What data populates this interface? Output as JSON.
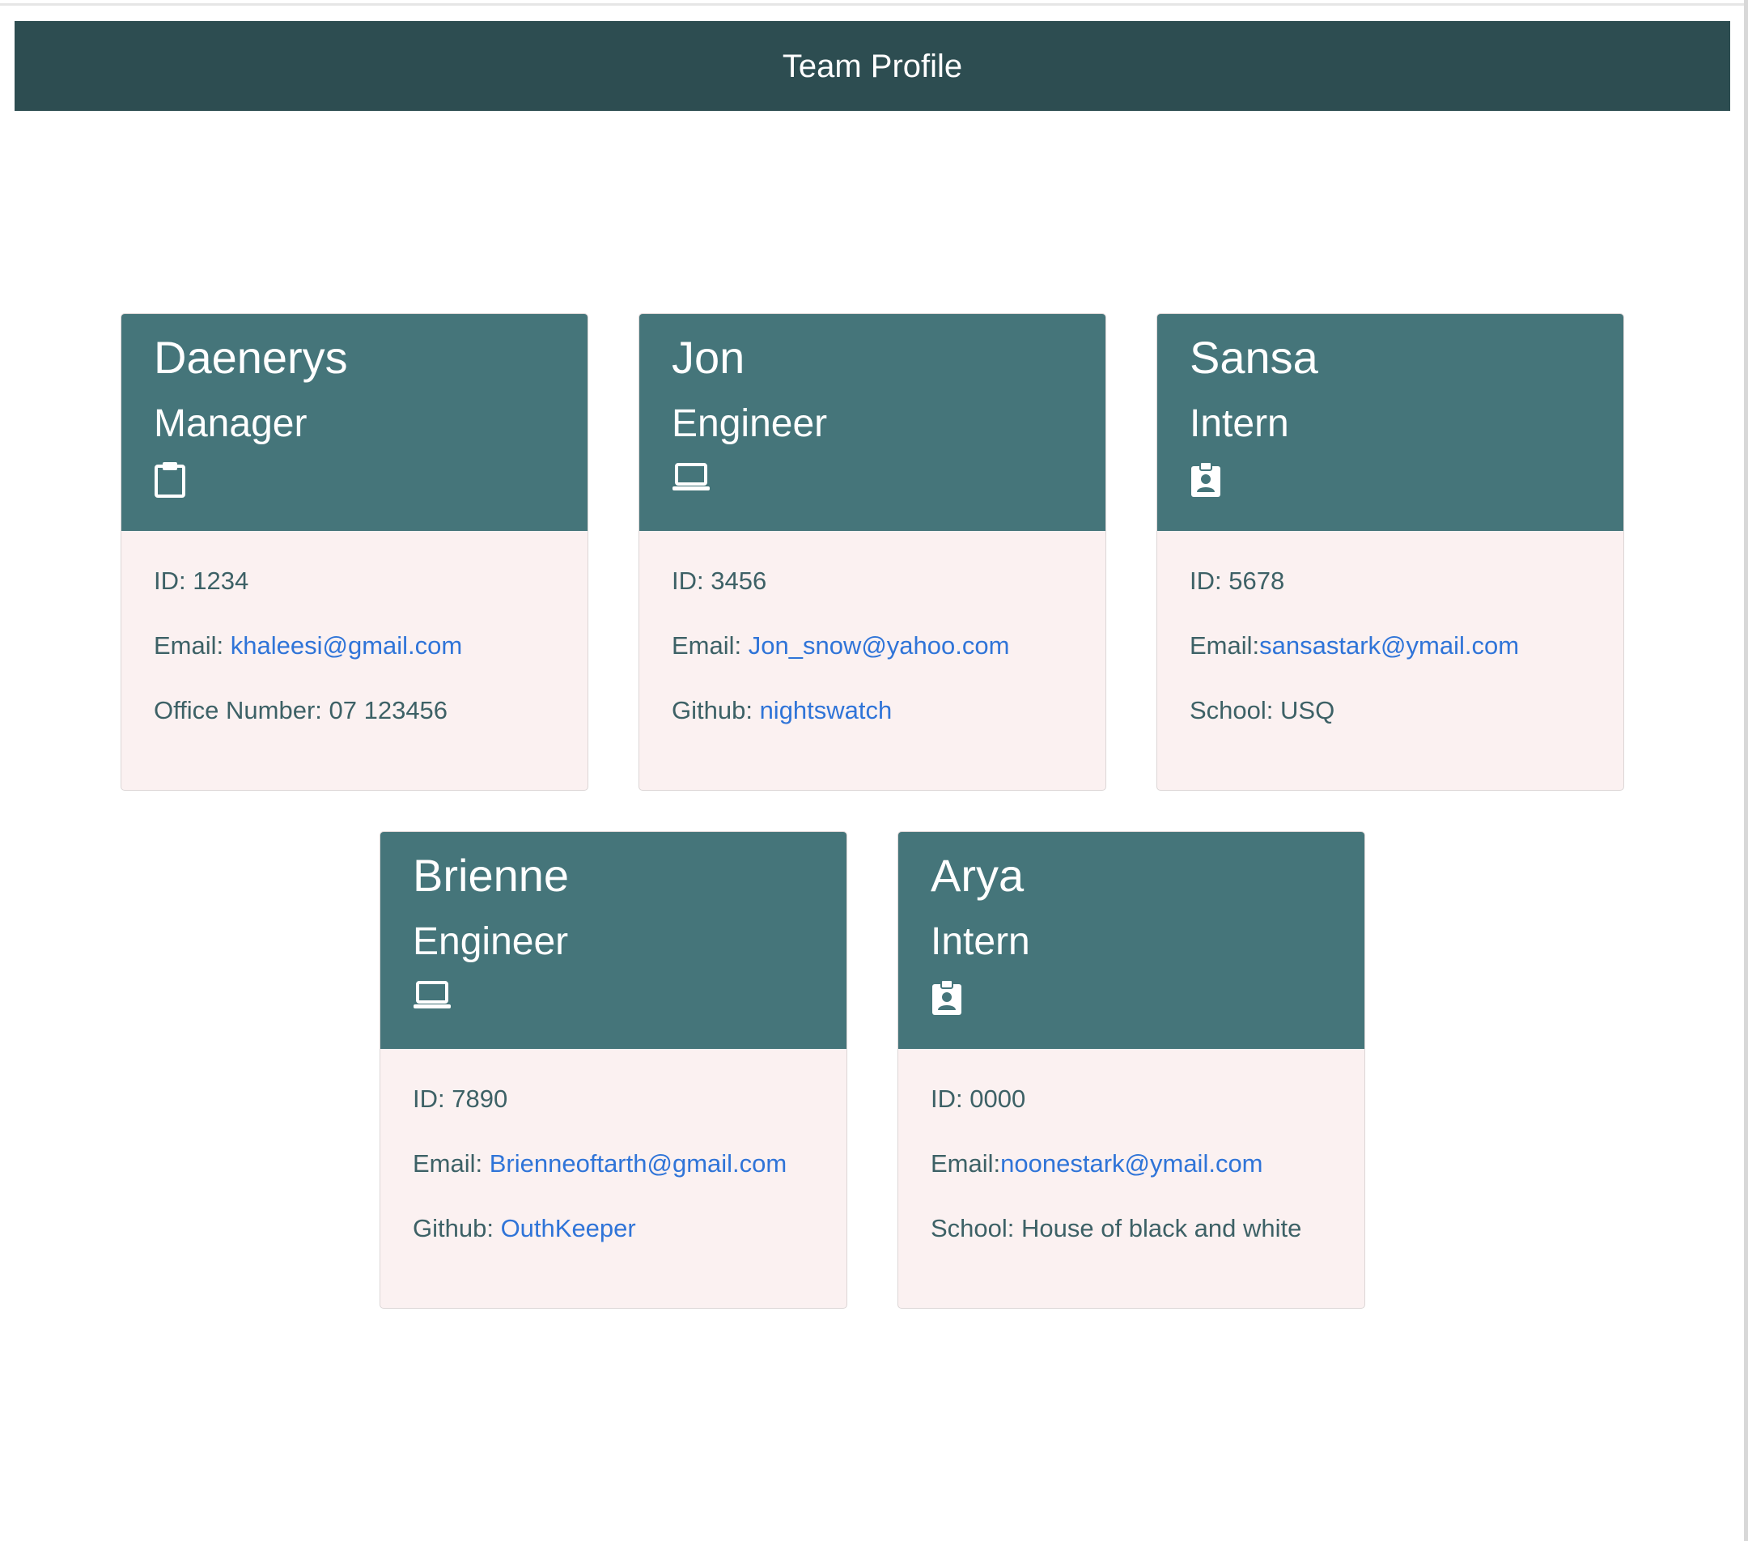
{
  "header": {
    "title": "Team Profile"
  },
  "cards": [
    {
      "name": "Daenerys",
      "role": "Manager",
      "icon": "clipboard-icon",
      "id_label": "ID: 1234",
      "email_label": "Email: ",
      "email": "khaleesi@gmail.com",
      "extra_label": "Office Number: 07 123456",
      "extra_link": ""
    },
    {
      "name": "Jon",
      "role": "Engineer",
      "icon": "laptop-icon",
      "id_label": "ID: 3456",
      "email_label": "Email: ",
      "email": "Jon_snow@yahoo.com",
      "extra_label": "Github: ",
      "extra_link": "nightswatch"
    },
    {
      "name": "Sansa",
      "role": "Intern",
      "icon": "id-badge-icon",
      "id_label": "ID: 5678",
      "email_label": "Email:",
      "email": "sansastark@ymail.com",
      "extra_label": "School: USQ",
      "extra_link": ""
    },
    {
      "name": "Brienne",
      "role": "Engineer",
      "icon": "laptop-icon",
      "id_label": "ID: 7890",
      "email_label": "Email: ",
      "email": "Brienneoftarth@gmail.com",
      "extra_label": "Github: ",
      "extra_link": "OuthKeeper"
    },
    {
      "name": "Arya",
      "role": "Intern",
      "icon": "id-badge-icon",
      "id_label": "ID: 0000",
      "email_label": "Email:",
      "email": "noonestark@ymail.com",
      "extra_label": "School: House of black and white",
      "extra_link": ""
    }
  ],
  "colors": {
    "header_bg": "#2d4d51",
    "card_head_bg": "#45757a",
    "card_body_bg": "#fbf1f1",
    "body_text": "#3d6166",
    "link": "#2f74d8"
  }
}
